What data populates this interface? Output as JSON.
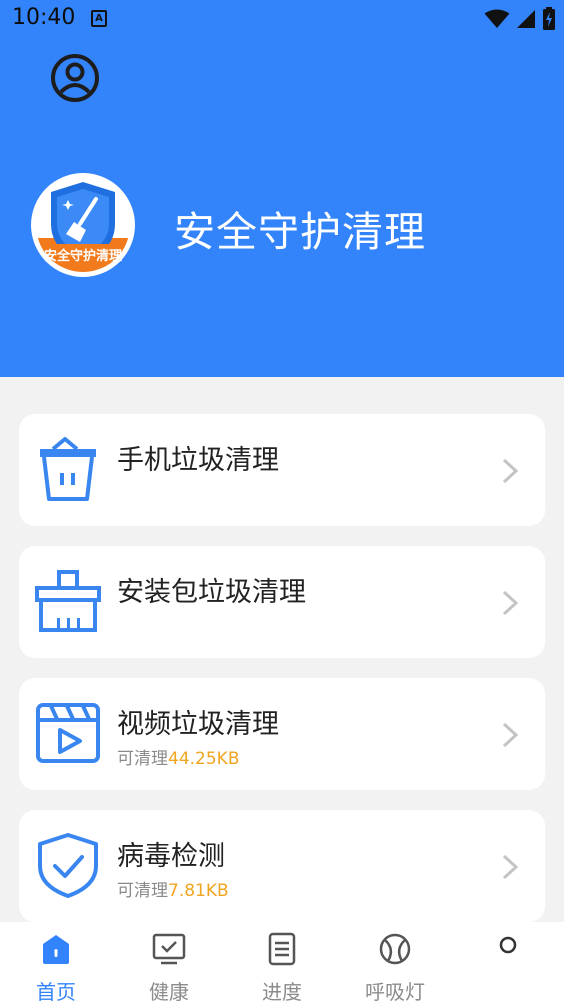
{
  "status_bar": {
    "time": "10:40",
    "notif_glyph": "A"
  },
  "app": {
    "title": "安全守护清理",
    "logo_text": "安全守护清理"
  },
  "cards": [
    {
      "title": "手机垃圾清理",
      "icon": "trash-icon"
    },
    {
      "title": "安装包垃圾清理",
      "icon": "broom-icon"
    },
    {
      "title": "视频垃圾清理",
      "sub_label": "可清理",
      "sub_value": "44.25KB",
      "icon": "video-icon"
    },
    {
      "title": "病毒检测",
      "sub_label": "可清理",
      "sub_value": "7.81KB",
      "icon": "shield-check-icon"
    }
  ],
  "tabs": [
    {
      "label": "首页",
      "icon": "home-icon",
      "active": true
    },
    {
      "label": "健康",
      "icon": "tv-check-icon"
    },
    {
      "label": "进度",
      "icon": "document-icon"
    },
    {
      "label": "呼吸灯",
      "icon": "ball-icon"
    },
    {
      "label": "",
      "icon": "circle-icon"
    }
  ],
  "colors": {
    "primary": "#3384fb",
    "accent": "#f0a520",
    "background": "#f2f2f2"
  }
}
